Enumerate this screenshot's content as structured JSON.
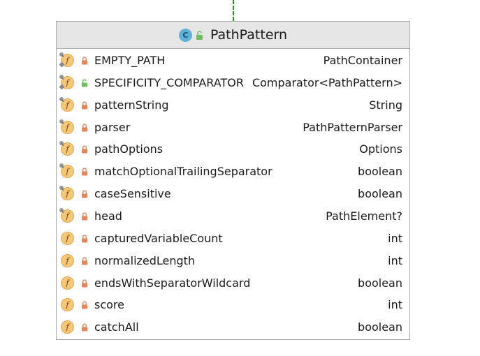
{
  "class": {
    "name": "PathPattern",
    "icon": "class-icon",
    "icon_letter": "C",
    "visibility": "public"
  },
  "colors": {
    "field_icon": "#f6c77a",
    "private_lock": "#e8845a",
    "public_lock": "#6cbf5a",
    "class_icon": "#5fb1d8",
    "connector": "#2e8b2e"
  },
  "fields": [
    {
      "name": "EMPTY_PATH",
      "type": "PathContainer",
      "visibility": "private",
      "static": true,
      "final": true
    },
    {
      "name": "SPECIFICITY_COMPARATOR",
      "type": "Comparator<PathPattern>",
      "visibility": "public",
      "static": true,
      "final": true
    },
    {
      "name": "patternString",
      "type": "String",
      "visibility": "private",
      "static": false,
      "final": true
    },
    {
      "name": "parser",
      "type": "PathPatternParser",
      "visibility": "private",
      "static": false,
      "final": true
    },
    {
      "name": "pathOptions",
      "type": "Options",
      "visibility": "private",
      "static": false,
      "final": true
    },
    {
      "name": "matchOptionalTrailingSeparator",
      "type": "boolean",
      "visibility": "private",
      "static": false,
      "final": true
    },
    {
      "name": "caseSensitive",
      "type": "boolean",
      "visibility": "private",
      "static": false,
      "final": true
    },
    {
      "name": "head",
      "type": "PathElement?",
      "visibility": "private",
      "static": false,
      "final": true
    },
    {
      "name": "capturedVariableCount",
      "type": "int",
      "visibility": "private",
      "static": false,
      "final": false
    },
    {
      "name": "normalizedLength",
      "type": "int",
      "visibility": "private",
      "static": false,
      "final": false
    },
    {
      "name": "endsWithSeparatorWildcard",
      "type": "boolean",
      "visibility": "private",
      "static": false,
      "final": false
    },
    {
      "name": "score",
      "type": "int",
      "visibility": "private",
      "static": false,
      "final": false
    },
    {
      "name": "catchAll",
      "type": "boolean",
      "visibility": "private",
      "static": false,
      "final": false
    }
  ]
}
